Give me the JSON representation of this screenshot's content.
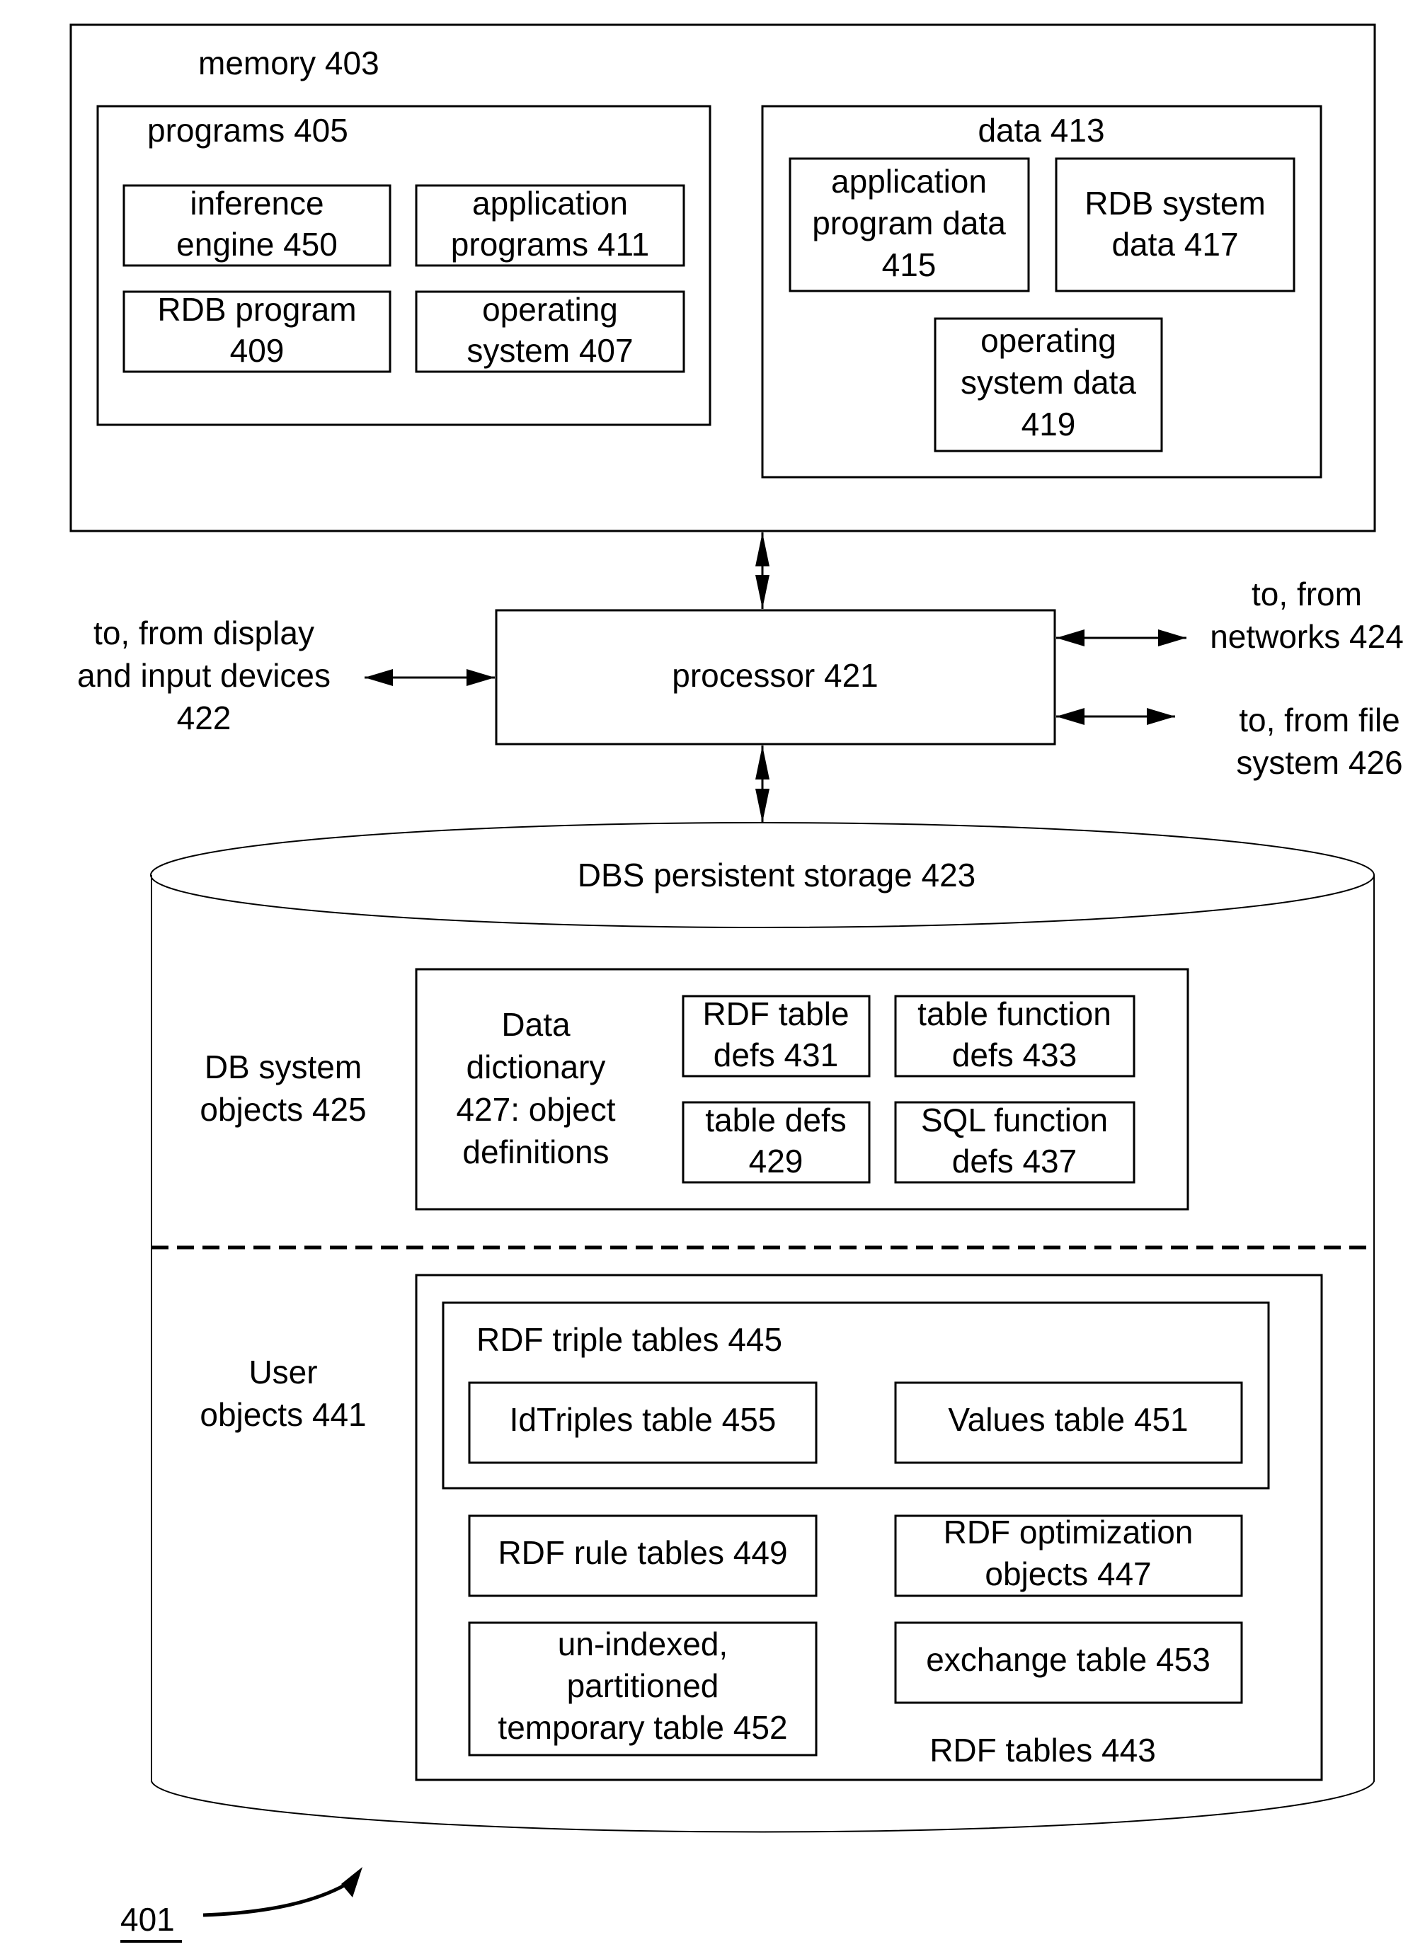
{
  "figure": {
    "reference_label": "401",
    "memory": {
      "label": "memory 403",
      "programs": {
        "label": "programs 405",
        "items": [
          {
            "lines": [
              "inference",
              "engine 450"
            ]
          },
          {
            "lines": [
              "application",
              "programs 411"
            ]
          },
          {
            "lines": [
              "RDB program",
              "409"
            ]
          },
          {
            "lines": [
              "operating",
              "system 407"
            ]
          }
        ]
      },
      "data": {
        "label": "data 413",
        "items": [
          {
            "lines": [
              "application",
              "program data",
              "415"
            ]
          },
          {
            "lines": [
              "RDB system",
              "data 417"
            ]
          },
          {
            "lines": [
              "operating",
              "system data",
              "419"
            ]
          }
        ]
      }
    },
    "processor": {
      "label": "processor 421"
    },
    "io": {
      "display": {
        "lines": [
          "to, from display",
          "and input devices",
          "422"
        ]
      },
      "networks": {
        "lines": [
          "to, from",
          "networks 424"
        ]
      },
      "file_system": {
        "lines": [
          "to, from file",
          "system 426"
        ]
      }
    },
    "storage": {
      "label": "DBS persistent storage 423",
      "db_system_objects": {
        "lines": [
          "DB system",
          "objects 425"
        ],
        "dictionary": {
          "lines": [
            "Data",
            "dictionary",
            "427: object",
            "definitions"
          ]
        },
        "items": [
          {
            "lines": [
              "RDF table",
              "defs 431"
            ]
          },
          {
            "lines": [
              "table function",
              "defs 433"
            ]
          },
          {
            "lines": [
              "table defs",
              "429"
            ]
          },
          {
            "lines": [
              "SQL function",
              "defs 437"
            ]
          }
        ]
      },
      "user_objects": {
        "lines": [
          "User",
          "objects 441"
        ],
        "rdf_tables_label": "RDF tables 443",
        "triple_tables": {
          "label": "RDF triple tables 445",
          "items": [
            {
              "lines": [
                "IdTriples table 455"
              ]
            },
            {
              "lines": [
                "Values table 451"
              ]
            }
          ]
        },
        "items": [
          {
            "lines": [
              "RDF rule tables 449"
            ]
          },
          {
            "lines": [
              "RDF optimization",
              "objects 447"
            ]
          },
          {
            "lines": [
              "un-indexed,",
              "partitioned",
              "temporary table 452"
            ]
          },
          {
            "lines": [
              "exchange table 453"
            ]
          }
        ]
      }
    }
  }
}
